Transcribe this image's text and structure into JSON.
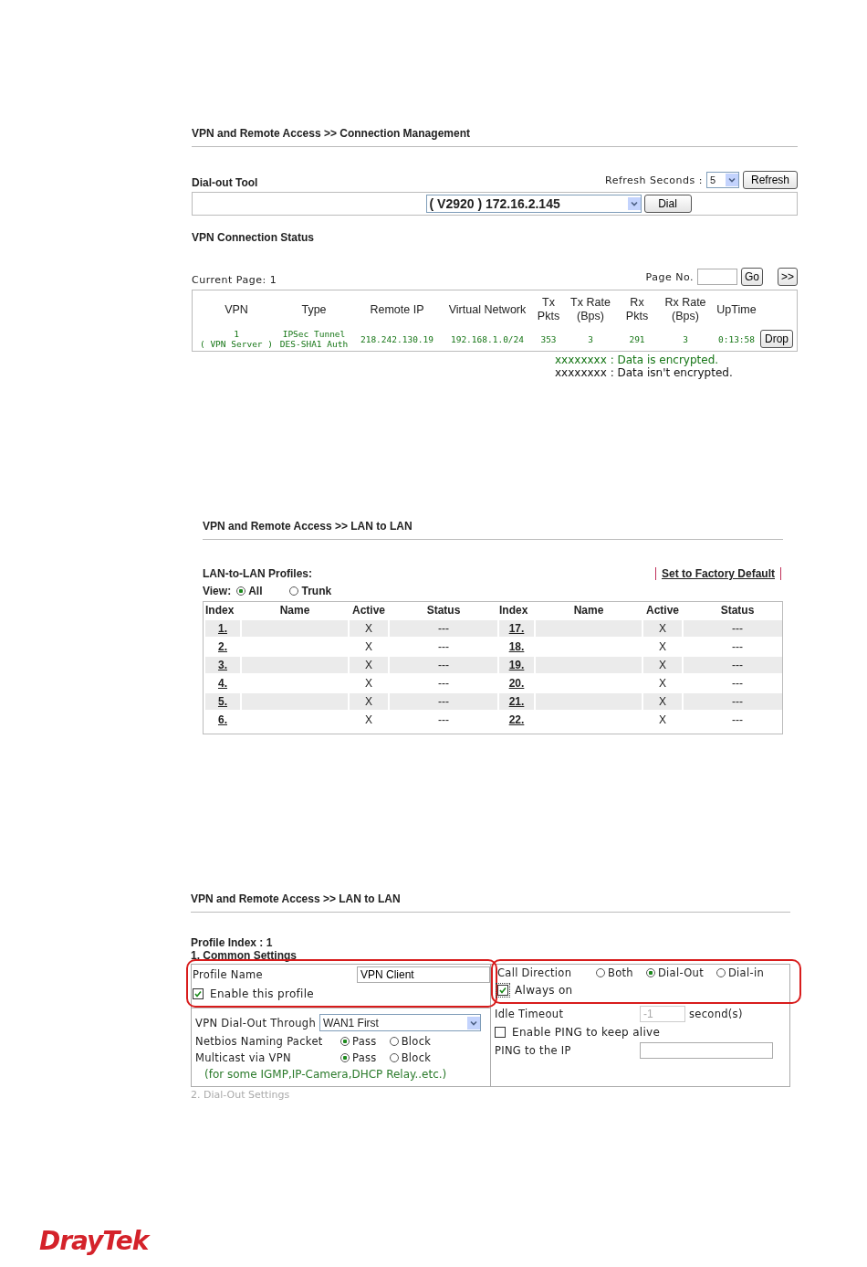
{
  "connection_management": {
    "title": "VPN and Remote Access >> Connection Management",
    "dial_out_tool": {
      "label": "Dial-out Tool",
      "refresh_label": "Refresh Seconds :",
      "refresh_value": "5",
      "refresh_button": "Refresh",
      "profile": "( V2920 ) 172.16.2.145",
      "dial_button": "Dial"
    },
    "status": {
      "title": "VPN Connection Status",
      "current_page": "Current Page: 1",
      "page_label": "Page No.",
      "go_button": "Go",
      "next_button": ">>",
      "columns": [
        "VPN",
        "Type",
        "Remote IP",
        "Virtual Network",
        "Tx\nPkts",
        "Tx Rate\n(Bps)",
        "Rx\nPkts",
        "Rx Rate\n(Bps)",
        "UpTime"
      ],
      "rows": [
        {
          "vpn": "1",
          "vpn_mode": "( VPN Server )",
          "type": "IPSec Tunnel",
          "auth": "DES-SHA1 Auth",
          "remote_ip": "218.242.130.19",
          "virtual_network": "192.168.1.0/24",
          "tx_pkts": "353",
          "tx_rate": "3",
          "rx_pkts": "291",
          "rx_rate": "3",
          "uptime": "0:13:58",
          "encrypted": true,
          "action": "Drop"
        }
      ],
      "legend": [
        {
          "text": "xxxxxxxx : Data is encrypted.",
          "encrypted": true
        },
        {
          "text": "xxxxxxxx : Data isn't encrypted.",
          "encrypted": false
        }
      ]
    }
  },
  "lan_to_lan_list": {
    "title": "VPN and Remote Access >> LAN to LAN",
    "profiles_label": "LAN-to-LAN Profiles:",
    "factory_default_link": "Set to Factory Default",
    "view_label": "View:",
    "view_options": [
      {
        "label": "All",
        "selected": true
      },
      {
        "label": "Trunk",
        "selected": false
      }
    ],
    "columns": [
      "Index",
      "Name",
      "Active",
      "Status",
      "Index",
      "Name",
      "Active",
      "Status"
    ],
    "rows": [
      {
        "left": {
          "index": "1.",
          "active": "X",
          "status": "---"
        },
        "right": {
          "index": "17.",
          "active": "X",
          "status": "---"
        }
      },
      {
        "left": {
          "index": "2.",
          "active": "X",
          "status": "---"
        },
        "right": {
          "index": "18.",
          "active": "X",
          "status": "---"
        }
      },
      {
        "left": {
          "index": "3.",
          "active": "X",
          "status": "---"
        },
        "right": {
          "index": "19.",
          "active": "X",
          "status": "---"
        }
      },
      {
        "left": {
          "index": "4.",
          "active": "X",
          "status": "---"
        },
        "right": {
          "index": "20.",
          "active": "X",
          "status": "---"
        }
      },
      {
        "left": {
          "index": "5.",
          "active": "X",
          "status": "---"
        },
        "right": {
          "index": "21.",
          "active": "X",
          "status": "---"
        }
      },
      {
        "left": {
          "index": "6.",
          "active": "X",
          "status": "---"
        },
        "right": {
          "index": "22.",
          "active": "X",
          "status": "---"
        }
      }
    ]
  },
  "lan_to_lan_profile": {
    "title": "VPN and Remote Access >> LAN to LAN",
    "profile_index": "Profile Index : 1",
    "section": "1. Common Settings",
    "profile_name": {
      "label": "Profile Name",
      "value": "VPN Client"
    },
    "enable_profile": {
      "label": "Enable this profile",
      "checked": true
    },
    "dial_out_through": {
      "label": "VPN Dial-Out Through",
      "value": "WAN1 First"
    },
    "netbios": {
      "label": "Netbios Naming Packet",
      "options": [
        {
          "label": "Pass",
          "selected": true
        },
        {
          "label": "Block",
          "selected": false
        }
      ]
    },
    "multicast": {
      "label": "Multicast via VPN",
      "options": [
        {
          "label": "Pass",
          "selected": true
        },
        {
          "label": "Block",
          "selected": false
        }
      ]
    },
    "multicast_note": "(for some IGMP,IP-Camera,DHCP Relay..etc.)",
    "call_direction": {
      "label": "Call Direction",
      "options": [
        {
          "label": "Both",
          "selected": false
        },
        {
          "label": "Dial-Out",
          "selected": true
        },
        {
          "label": "Dial-in",
          "selected": false
        }
      ]
    },
    "always_on": {
      "label": "Always on",
      "checked": true
    },
    "idle_timeout": {
      "label": "Idle Timeout",
      "value": "-1",
      "disabled": true,
      "unit": "second(s)"
    },
    "enable_ping": {
      "label": "Enable PING to keep alive",
      "checked": false
    },
    "ping_ip": {
      "label": "PING to the IP"
    },
    "next_section": "2. Dial-Out Settings"
  },
  "footer": {
    "logo": "DrayTek"
  }
}
